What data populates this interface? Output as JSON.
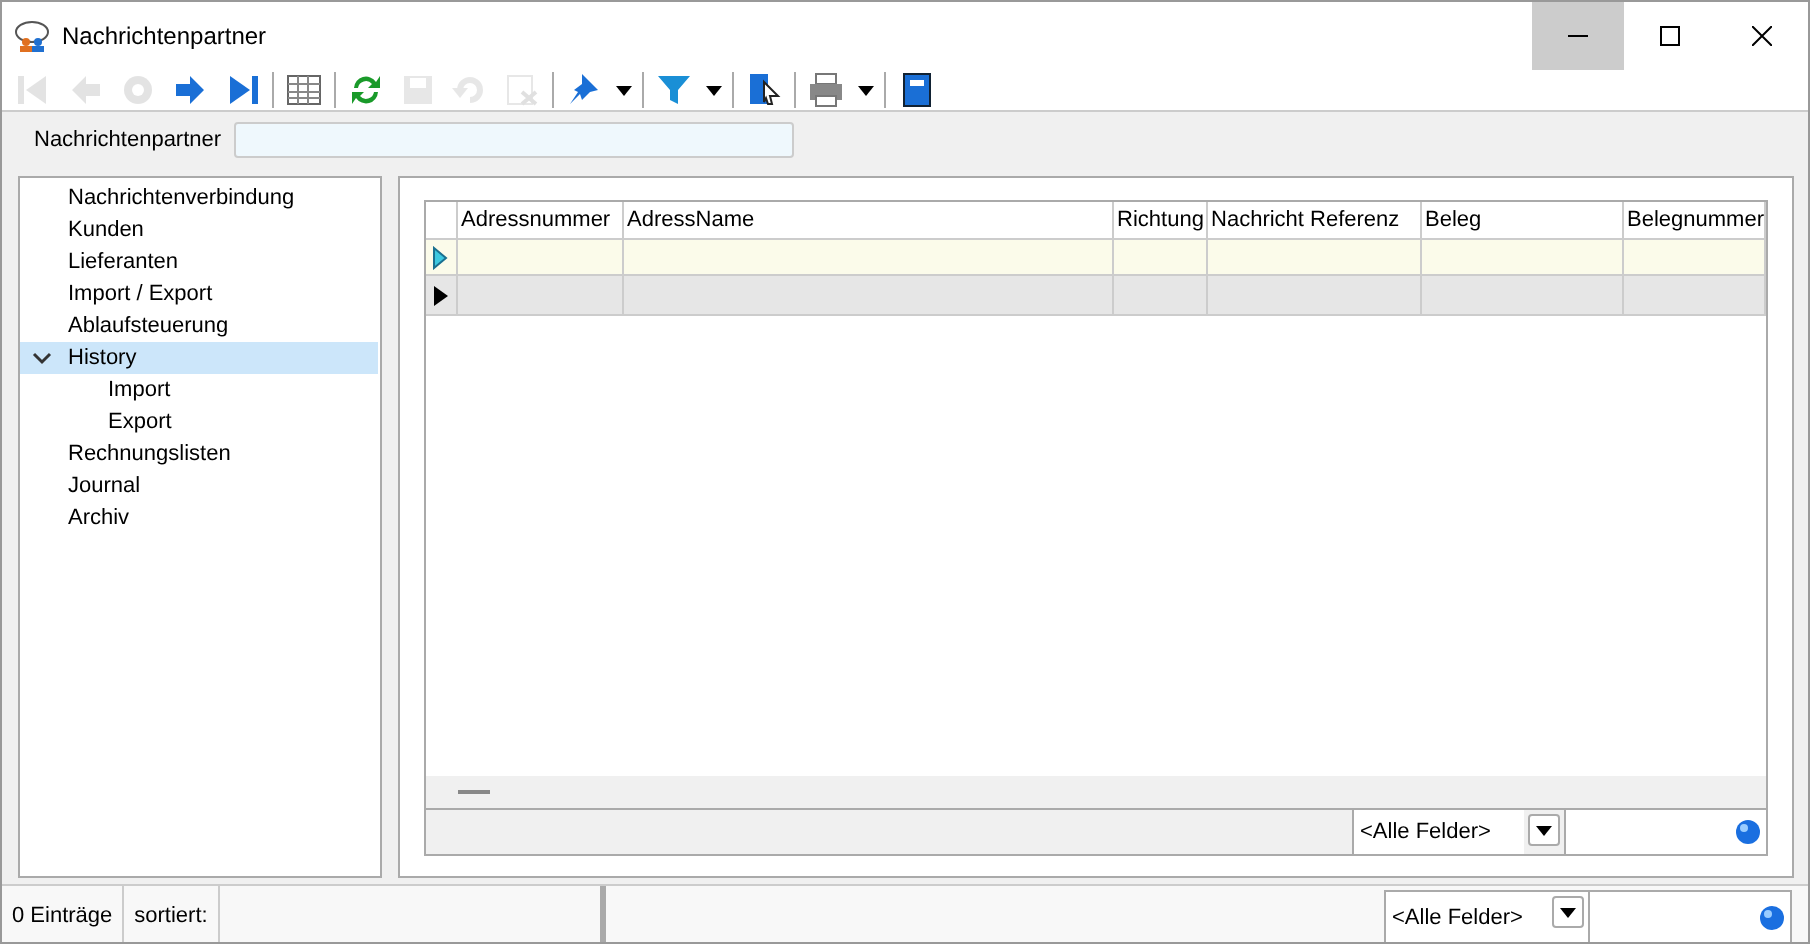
{
  "window": {
    "title": "Nachrichtenpartner"
  },
  "toolbar": [
    {
      "kind": "first",
      "disabled": true
    },
    {
      "kind": "prev",
      "disabled": true
    },
    {
      "kind": "goto",
      "disabled": true
    },
    {
      "kind": "next",
      "disabled": false
    },
    {
      "kind": "last",
      "disabled": false
    },
    {
      "kind": "sep"
    },
    {
      "kind": "table",
      "disabled": false
    },
    {
      "kind": "sep"
    },
    {
      "kind": "refresh",
      "disabled": false
    },
    {
      "kind": "save",
      "disabled": true
    },
    {
      "kind": "undo",
      "disabled": true
    },
    {
      "kind": "delete",
      "disabled": true
    },
    {
      "kind": "sep"
    },
    {
      "kind": "pin",
      "disabled": false,
      "dropdown": true
    },
    {
      "kind": "sep"
    },
    {
      "kind": "filter",
      "disabled": false,
      "dropdown": true
    },
    {
      "kind": "sep"
    },
    {
      "kind": "select",
      "disabled": false
    },
    {
      "kind": "sep"
    },
    {
      "kind": "print",
      "disabled": false,
      "dropdown": true
    },
    {
      "kind": "sep"
    },
    {
      "kind": "book",
      "disabled": false
    }
  ],
  "filter": {
    "label": "Nachrichtenpartner"
  },
  "tree": [
    {
      "label": "Nachrichtenverbindung",
      "selected": false
    },
    {
      "label": "Kunden",
      "selected": false
    },
    {
      "label": "Lieferanten",
      "selected": false
    },
    {
      "label": "Import / Export",
      "selected": false
    },
    {
      "label": "Ablaufsteuerung",
      "selected": false
    },
    {
      "label": "History",
      "selected": true,
      "expanded": true,
      "children": [
        {
          "label": "Import",
          "selected": false
        },
        {
          "label": "Export",
          "selected": false
        }
      ]
    },
    {
      "label": "Rechnungslisten",
      "selected": false
    },
    {
      "label": "Journal",
      "selected": false
    },
    {
      "label": "Archiv",
      "selected": false
    }
  ],
  "table": {
    "columns": [
      "Adressnummer",
      "AdressName",
      "Richtung",
      "Nachricht Referenz",
      "Beleg",
      "Belegnummer"
    ],
    "rows": [
      {
        "kind": "current"
      },
      {
        "kind": "new"
      }
    ],
    "footer": {
      "combo": "<Alle Felder>"
    }
  },
  "status_bar": {
    "count": "0 Einträge",
    "sort": "sortiert:",
    "combo": "<Alle Felder>"
  }
}
